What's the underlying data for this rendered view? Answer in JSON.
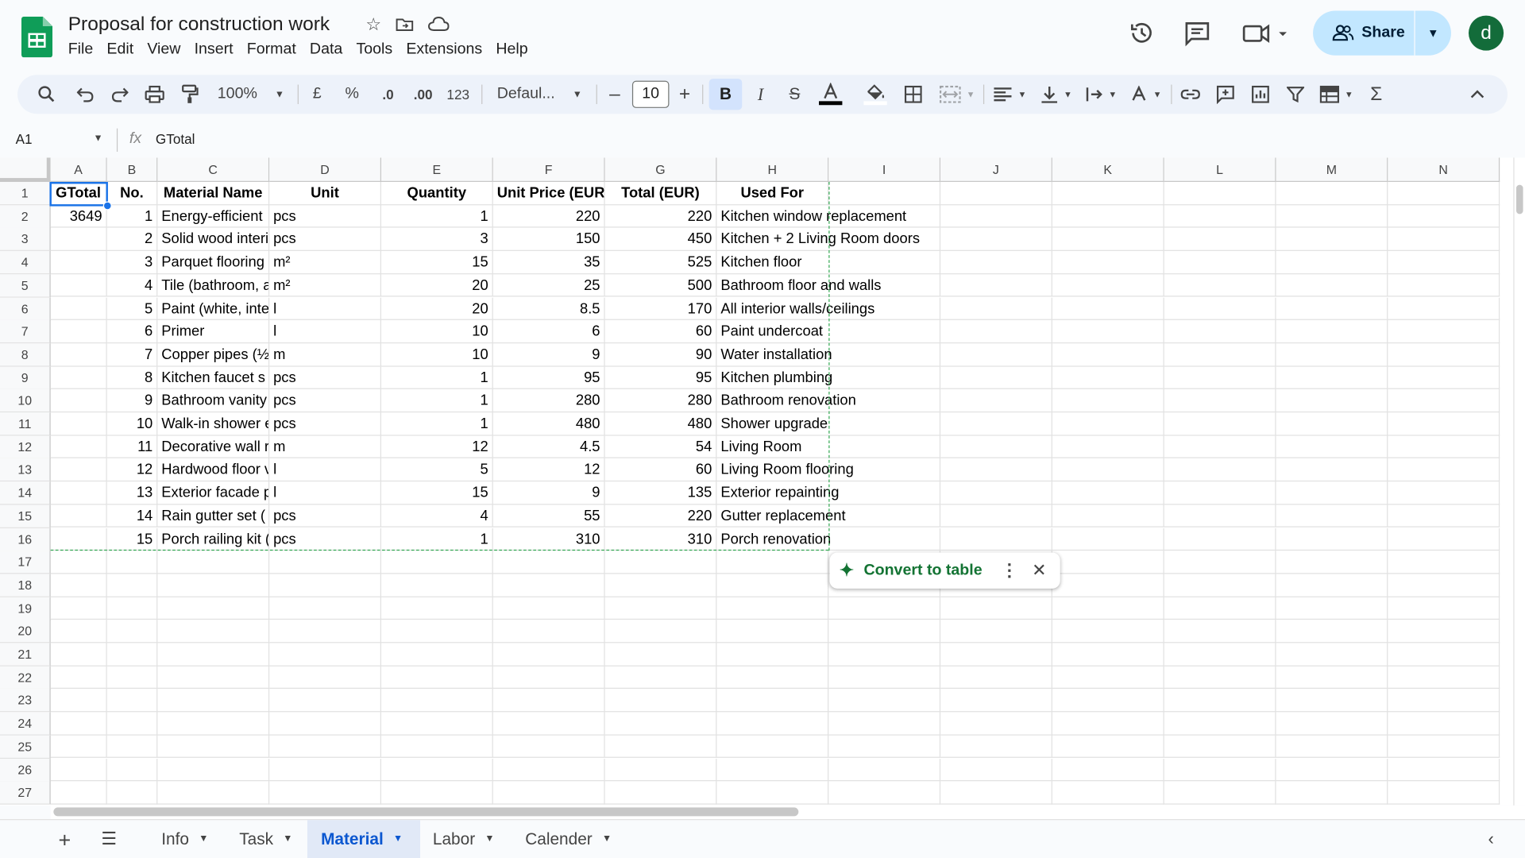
{
  "app": {
    "title": "Proposal for construction work",
    "avatar_letter": "d",
    "share_label": "Share"
  },
  "menu": [
    "File",
    "Edit",
    "View",
    "Insert",
    "Format",
    "Data",
    "Tools",
    "Extensions",
    "Help"
  ],
  "toolbar": {
    "zoom": "100%",
    "currency": "£",
    "percent": "%",
    "dec_decrease": ".0",
    "dec_increase": ".00",
    "number_format": "123",
    "font": "Defaul...",
    "font_size": "10"
  },
  "formula_bar": {
    "cell_ref": "A1",
    "fx": "fx",
    "value": "GTotal"
  },
  "columns": [
    "A",
    "B",
    "C",
    "D",
    "E",
    "F",
    "G",
    "H",
    "I",
    "J",
    "K",
    "L",
    "M",
    "N"
  ],
  "rows": [
    "1",
    "2",
    "3",
    "4",
    "5",
    "6",
    "7",
    "8",
    "9",
    "10",
    "11",
    "12",
    "13",
    "14",
    "15",
    "16",
    "17",
    "18",
    "19",
    "20",
    "21",
    "22",
    "23",
    "24",
    "25",
    "26",
    "27"
  ],
  "headers": [
    "GTotal",
    "No.",
    "Material Name",
    "Unit",
    "Quantity",
    "Unit Price (EUR)",
    "Total (EUR)",
    "Used For"
  ],
  "grand_total": "3649",
  "table": [
    [
      "1",
      "Energy-efficient",
      "pcs",
      "1",
      "220",
      "220",
      "Kitchen window replacement"
    ],
    [
      "2",
      "Solid wood interi",
      "pcs",
      "3",
      "150",
      "450",
      "Kitchen + 2 Living Room doors"
    ],
    [
      "3",
      "Parquet flooring",
      "m²",
      "15",
      "35",
      "525",
      "Kitchen floor"
    ],
    [
      "4",
      "Tile (bathroom, a",
      "m²",
      "20",
      "25",
      "500",
      "Bathroom floor and walls"
    ],
    [
      "5",
      "Paint (white, inte",
      "l",
      "20",
      "8.5",
      "170",
      "All interior walls/ceilings"
    ],
    [
      "6",
      "Primer",
      "l",
      "10",
      "6",
      "60",
      "Paint undercoat"
    ],
    [
      "7",
      "Copper pipes (½",
      "m",
      "10",
      "9",
      "90",
      "Water installation"
    ],
    [
      "8",
      "Kitchen faucet s",
      "pcs",
      "1",
      "95",
      "95",
      "Kitchen plumbing"
    ],
    [
      "9",
      "Bathroom vanity",
      "pcs",
      "1",
      "280",
      "280",
      "Bathroom renovation"
    ],
    [
      "10",
      "Walk-in shower e",
      "pcs",
      "1",
      "480",
      "480",
      "Shower upgrade"
    ],
    [
      "11",
      "Decorative wall r",
      "m",
      "12",
      "4.5",
      "54",
      "Living Room"
    ],
    [
      "12",
      "Hardwood floor v",
      "l",
      "5",
      "12",
      "60",
      "Living Room flooring"
    ],
    [
      "13",
      "Exterior facade p",
      "l",
      "15",
      "9",
      "135",
      "Exterior repainting"
    ],
    [
      "14",
      "Rain gutter set (",
      "pcs",
      "4",
      "55",
      "220",
      "Gutter replacement"
    ],
    [
      "15",
      "Porch railing kit (",
      "pcs",
      "1",
      "310",
      "310",
      "Porch renovation"
    ]
  ],
  "chip": {
    "label": "Convert to table"
  },
  "sheets": [
    {
      "name": "Info",
      "active": false
    },
    {
      "name": "Task",
      "active": false
    },
    {
      "name": "Material",
      "active": true
    },
    {
      "name": "Labor",
      "active": false
    },
    {
      "name": "Calender",
      "active": false
    }
  ],
  "colors": {
    "accent": "#1a73e8",
    "share_bg": "#c2e7ff",
    "active_tab": "#0b57d0",
    "chip_green": "#137333",
    "sheets_green": "#0f9d58"
  }
}
